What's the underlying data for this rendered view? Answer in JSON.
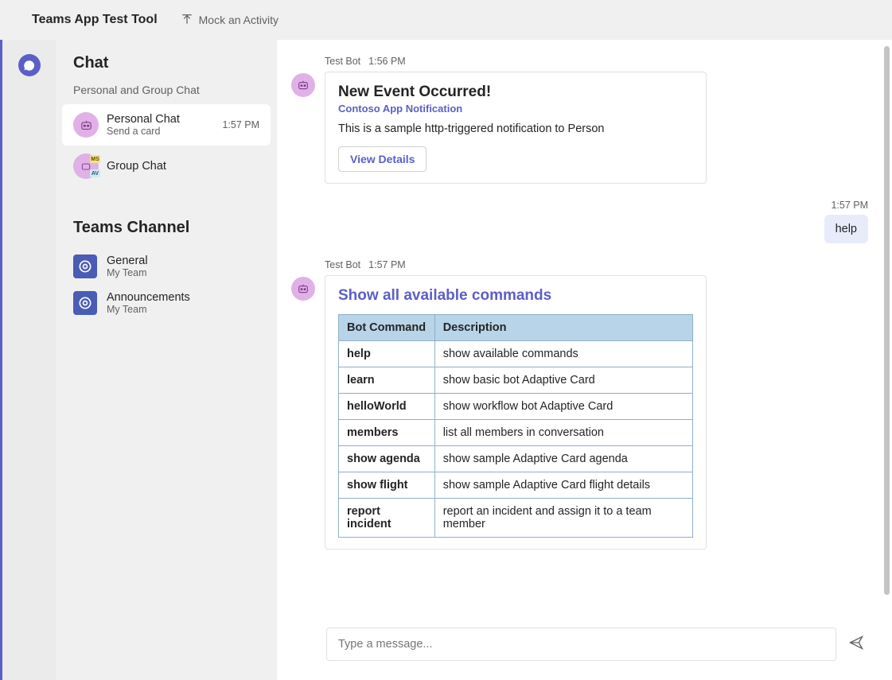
{
  "header": {
    "title": "Teams App Test Tool",
    "mock_label": "Mock an Activity"
  },
  "sidebar": {
    "chat_title": "Chat",
    "chat_subtitle": "Personal and Group Chat",
    "chats": [
      {
        "name": "Personal Chat",
        "sub": "Send a card",
        "time": "1:57 PM",
        "active": true,
        "avatar": "bot"
      },
      {
        "name": "Group Chat",
        "sub": "",
        "time": "",
        "active": false,
        "avatar": "group"
      }
    ],
    "channel_title": "Teams Channel",
    "channels": [
      {
        "name": "General",
        "sub": "My Team"
      },
      {
        "name": "Announcements",
        "sub": "My Team"
      }
    ]
  },
  "messages": {
    "card1": {
      "sender": "Test Bot",
      "time": "1:56 PM",
      "title": "New Event Occurred!",
      "subtitle": "Contoso App Notification",
      "body": "This is a sample http-triggered notification to Person",
      "button": "View Details"
    },
    "user1": {
      "time": "1:57 PM",
      "text": "help"
    },
    "card2": {
      "sender": "Test Bot",
      "time": "1:57 PM",
      "title": "Show all available commands",
      "table": {
        "headers": [
          "Bot Command",
          "Description"
        ],
        "rows": [
          [
            "help",
            "show available commands"
          ],
          [
            "learn",
            "show basic bot Adaptive Card"
          ],
          [
            "helloWorld",
            "show workflow bot Adaptive Card"
          ],
          [
            "members",
            "list all members in conversation"
          ],
          [
            "show agenda",
            "show sample Adaptive Card agenda"
          ],
          [
            "show flight",
            "show sample Adaptive Card flight details"
          ],
          [
            "report incident",
            "report an incident and assign it to a team member"
          ]
        ]
      }
    }
  },
  "composer": {
    "placeholder": "Type a message..."
  }
}
